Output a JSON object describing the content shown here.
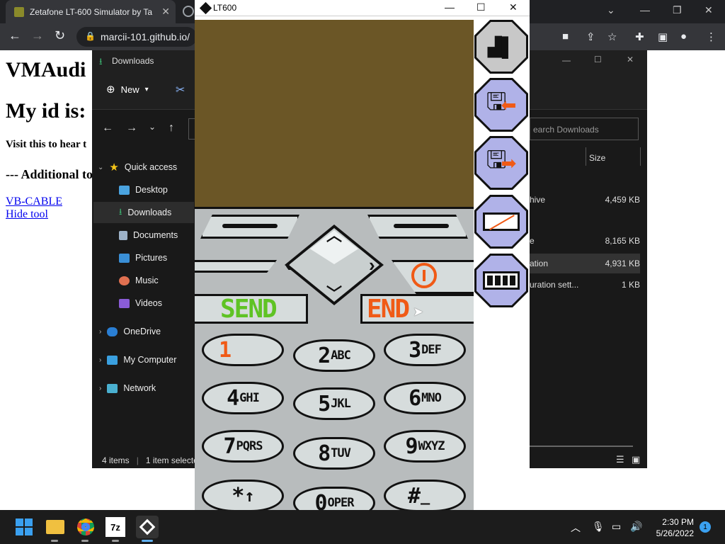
{
  "browser": {
    "tab_title": "Zetafone LT-600 Simulator by Ta",
    "url": "marcii-101.github.io/"
  },
  "webpage": {
    "heading1": "VMAudi",
    "heading2": "My id is:",
    "visit_text": "Visit this to hear t",
    "additional": "--- Additional to",
    "link1": "VB-CABLE",
    "link2": "Hide tool"
  },
  "explorer": {
    "title": "Downloads",
    "new_label": "New",
    "search_placeholder": "earch Downloads",
    "col_size": "Size",
    "sidebar": [
      {
        "label": "Quick access"
      },
      {
        "label": "Desktop"
      },
      {
        "label": "Downloads"
      },
      {
        "label": "Documents"
      },
      {
        "label": "Pictures"
      },
      {
        "label": "Music"
      },
      {
        "label": "Videos"
      },
      {
        "label": "OneDrive"
      },
      {
        "label": "My Computer"
      },
      {
        "label": "Network"
      }
    ],
    "files": [
      {
        "name": "hive",
        "size": "4,459 KB"
      },
      {
        "name": "e",
        "size": "8,165 KB"
      },
      {
        "name": "ation",
        "size": "4,931 KB"
      },
      {
        "name": "uration sett...",
        "size": "1 KB"
      }
    ],
    "status_items": "4 items",
    "status_selected": "1 item selecte"
  },
  "lt600": {
    "title": "LT600",
    "send_label": "SEND",
    "end_label": "END",
    "keys": [
      {
        "digit": "1",
        "letters": ""
      },
      {
        "digit": "2",
        "letters": "ABC"
      },
      {
        "digit": "3",
        "letters": "DEF"
      },
      {
        "digit": "4",
        "letters": "GHI"
      },
      {
        "digit": "5",
        "letters": "JKL"
      },
      {
        "digit": "6",
        "letters": "MNO"
      },
      {
        "digit": "7",
        "letters": "PQRS"
      },
      {
        "digit": "8",
        "letters": "TUV"
      },
      {
        "digit": "9",
        "letters": "WXYZ"
      },
      {
        "digit": "*",
        "letters": "↑"
      },
      {
        "digit": "0",
        "letters": "OPER"
      },
      {
        "digit": "#",
        "letters": "_"
      }
    ]
  },
  "taskbar": {
    "time": "2:30 PM",
    "date": "5/26/2022",
    "notification_count": "1"
  },
  "colors": {
    "screen": "#6b5626",
    "send": "#5fc324",
    "end": "#f05a16",
    "side_button": "#b0b2e8"
  }
}
